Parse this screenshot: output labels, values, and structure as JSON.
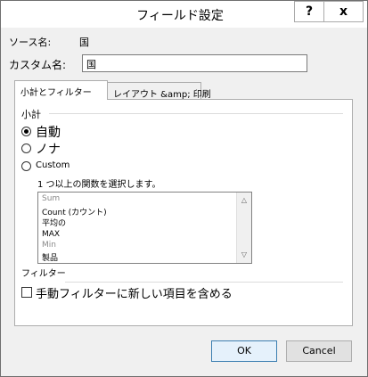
{
  "window": {
    "title": "フィールド設定",
    "help_label": "?",
    "close_label": "x"
  },
  "source": {
    "label": "ソース名:",
    "value": "国"
  },
  "custom_name": {
    "label": "カスタム名:",
    "value": "国"
  },
  "tabs": [
    {
      "label": "小計とフィルター",
      "active": true
    },
    {
      "label": "レイアウト &amp; 印刷",
      "active": false
    }
  ],
  "subtotals": {
    "heading": "小計",
    "options": [
      {
        "label": "自動",
        "selected": true
      },
      {
        "label": "ノナ",
        "selected": false
      },
      {
        "label": "Custom",
        "selected": false
      }
    ],
    "functions_prompt": "1 つ以上の関数を選択します。",
    "functions": [
      {
        "label": "Sum",
        "muted": true
      },
      {
        "label": "Count (カウント)",
        "muted": false
      },
      {
        "label": "平均の",
        "muted": false
      },
      {
        "label": "MAX",
        "muted": false
      },
      {
        "label": "Min",
        "muted": true
      },
      {
        "label": "製品",
        "muted": false
      }
    ]
  },
  "filter": {
    "heading": "フィルター",
    "include_new_items_label": "手動フィルターに新しい項目を含める",
    "include_new_items_checked": false
  },
  "footer": {
    "ok_label": "OK",
    "cancel_label": "Cancel"
  }
}
